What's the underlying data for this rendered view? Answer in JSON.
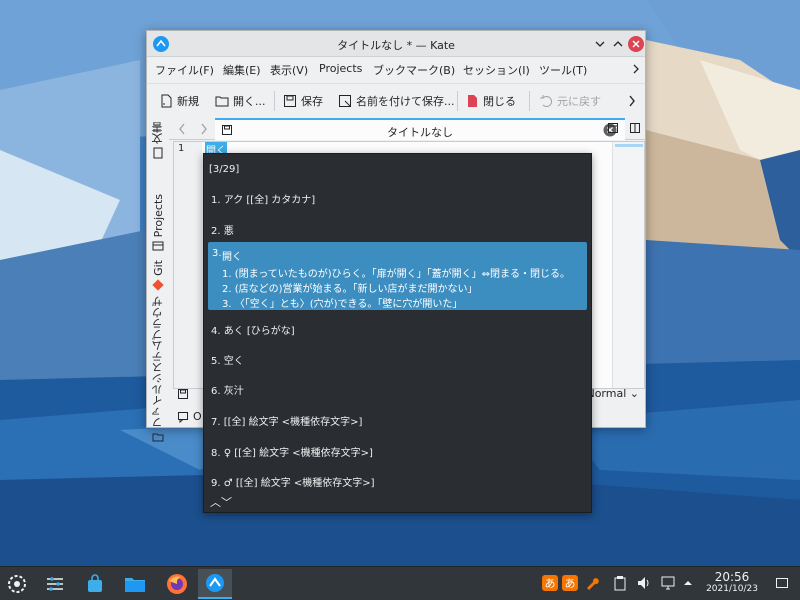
{
  "window": {
    "title": "タイトルなし * — Kate"
  },
  "menu": [
    "ファイル(F)",
    "編集(E)",
    "表示(V)",
    "Projects",
    "ブックマーク(B)",
    "セッション(I)",
    "ツール(T)"
  ],
  "toolbar": {
    "new": "新規",
    "open": "開く...",
    "save": "保存",
    "save_as": "名前を付けて保存...",
    "close": "閉じる",
    "undo": "元に戻す"
  },
  "sidebar": {
    "tabs": [
      "文書",
      "Projects",
      "Git",
      "ファイルシステムブラウザ"
    ]
  },
  "editor": {
    "tab_title": "タイトルなし",
    "line_number": "1",
    "text": "開く",
    "mode": "Normal",
    "bottom_partial": "O"
  },
  "ime": {
    "page": "[3/29]",
    "candidates": [
      "1. アク [[全] カタカナ]",
      "2. 悪",
      "4. あく [ひらがな]",
      "5. 空く",
      "6. 灰汁",
      "7. [[全] 絵文字 <機種依存文字>]",
      "8. ♀ [[全] 絵文字 <機種依存文字>]",
      "9. ♂ [[全] 絵文字 <機種依存文字>]"
    ],
    "selected": {
      "num": "3.",
      "word": "開く",
      "defs": [
        "1. (閉まっていたものが)ひらく。「扉が開く」「蓋が開く」⇔閉まる・閉じる。",
        "2. (店などの)営業が始まる。「新しい店がまだ開かない」",
        "3. 〈「空く」とも〉(穴が)できる。「壁に穴が開いた」"
      ]
    },
    "nav": "︿﹀"
  },
  "taskbar": {
    "time": "20:56",
    "date": "2021/10/23",
    "ime_a": "あ",
    "ime_b": "あ"
  },
  "colors": {
    "accent": "#3daee9",
    "ime_bg": "#2a2e32",
    "selected_bg": "#3d8ec0",
    "taskbar_bg": "#31363b"
  }
}
